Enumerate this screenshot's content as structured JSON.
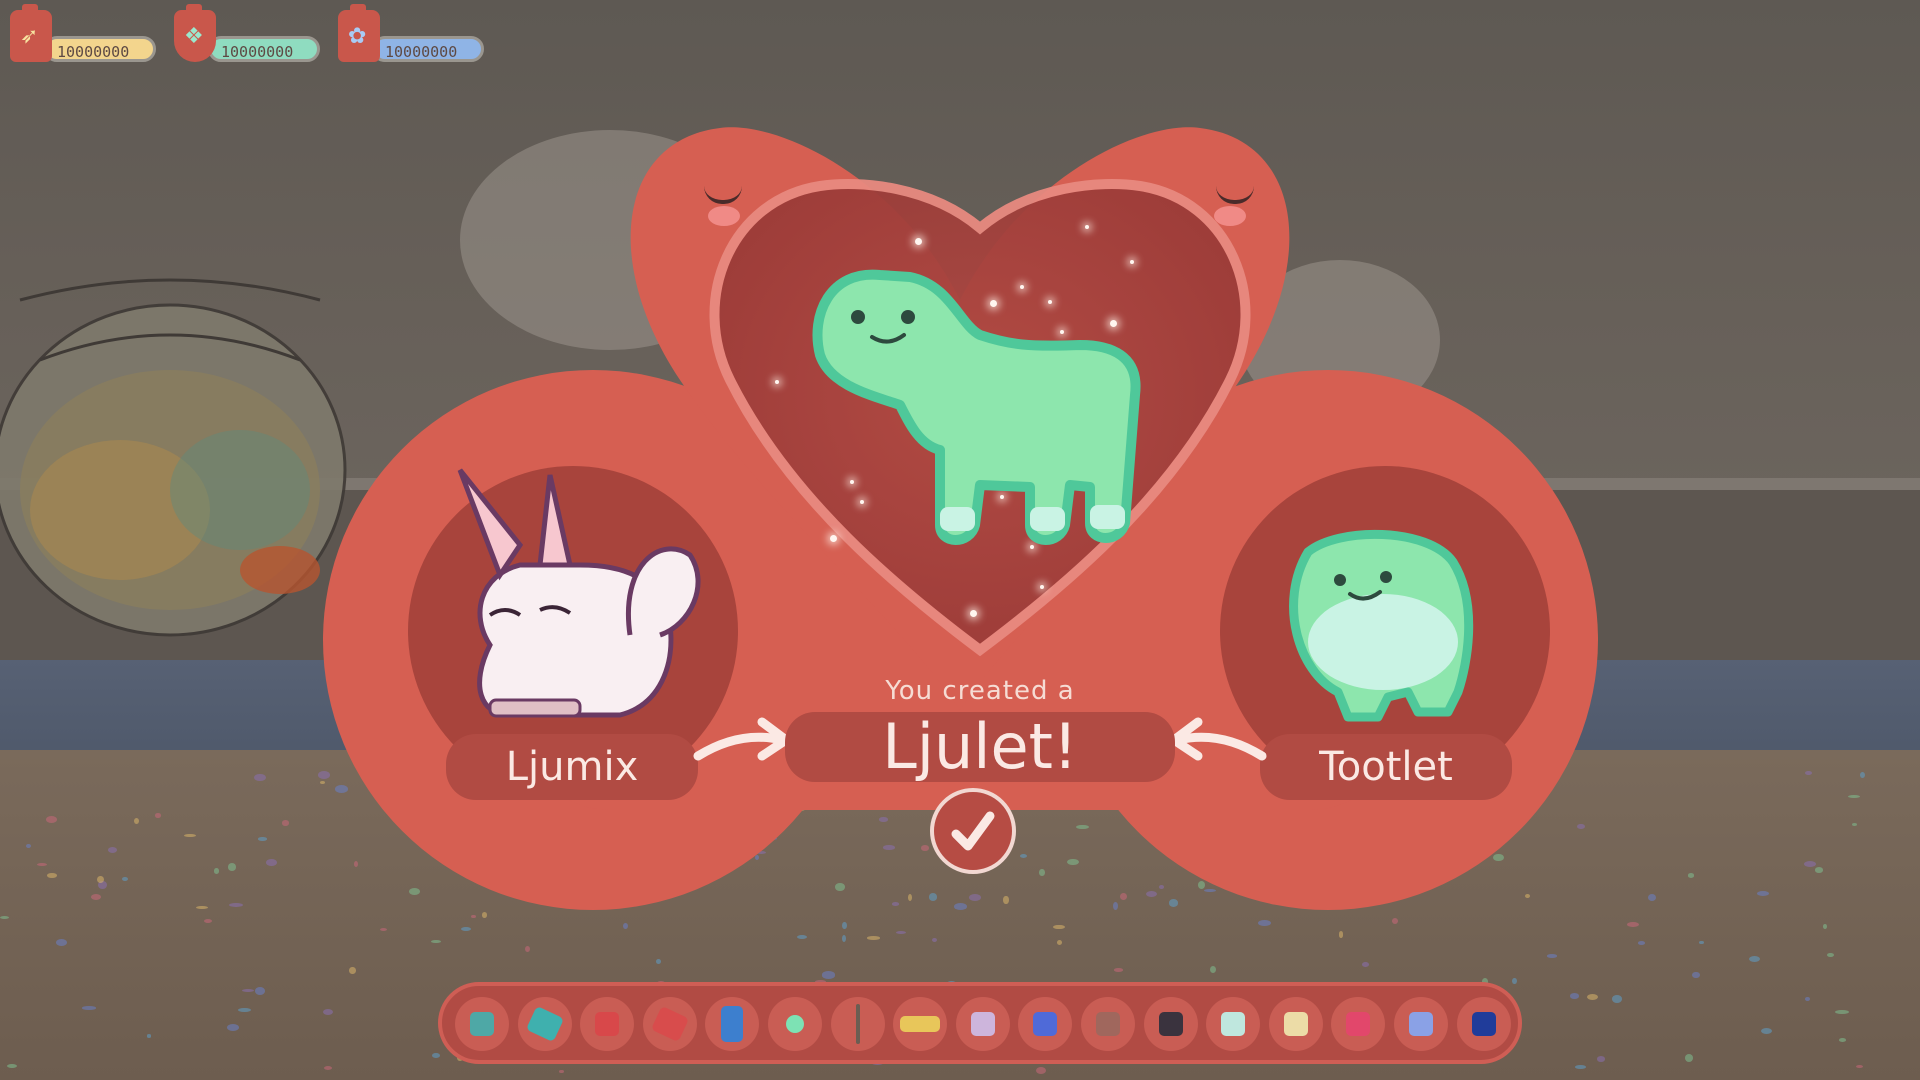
{
  "resources": [
    {
      "name": "feather",
      "value": "10000000",
      "icon": "feather-icon",
      "pill_color": "#f3d58d"
    },
    {
      "name": "candy",
      "value": "10000000",
      "icon": "candy-icon",
      "pill_color": "#8fdcc0"
    },
    {
      "name": "star",
      "value": "10000000",
      "icon": "star-icon",
      "pill_color": "#8fb4e6"
    }
  ],
  "breeding": {
    "parent_left": "Ljumix",
    "parent_right": "Tootlet",
    "created_prefix": "You created a",
    "result_name": "Ljulet!",
    "confirm_icon": "checkmark-icon"
  },
  "toolbar": {
    "items": [
      {
        "name": "teal-block",
        "color": "#4ea8a6"
      },
      {
        "name": "teal-sponge",
        "color": "#3fb0ae"
      },
      {
        "name": "red-block",
        "color": "#d8484a"
      },
      {
        "name": "red-dice",
        "color": "#d84c4c"
      },
      {
        "name": "blue-door",
        "color": "#3d7fce"
      },
      {
        "name": "lamp-bulb",
        "color": "#7de2b4"
      },
      {
        "name": "street-lamp",
        "color": "#6b5d52"
      },
      {
        "name": "bed",
        "color": "#e8c65a"
      },
      {
        "name": "lilac-block",
        "color": "#cdb5dc"
      },
      {
        "name": "blue-block",
        "color": "#4f6ad8"
      },
      {
        "name": "brown-block",
        "color": "#a0675d"
      },
      {
        "name": "dark-block",
        "color": "#3a333e"
      },
      {
        "name": "mint-block",
        "color": "#bfe7de"
      },
      {
        "name": "cream-block",
        "color": "#ecdca7"
      },
      {
        "name": "pink-block",
        "color": "#e2476b"
      },
      {
        "name": "periwinkle-block",
        "color": "#8aa1e6"
      },
      {
        "name": "night-poster",
        "color": "#203c9a"
      }
    ]
  },
  "colors": {
    "panel": "#d65f52",
    "panel_dark": "#a8443c",
    "creature_green": "#8de6ad",
    "creature_outline": "#4fc89a"
  }
}
